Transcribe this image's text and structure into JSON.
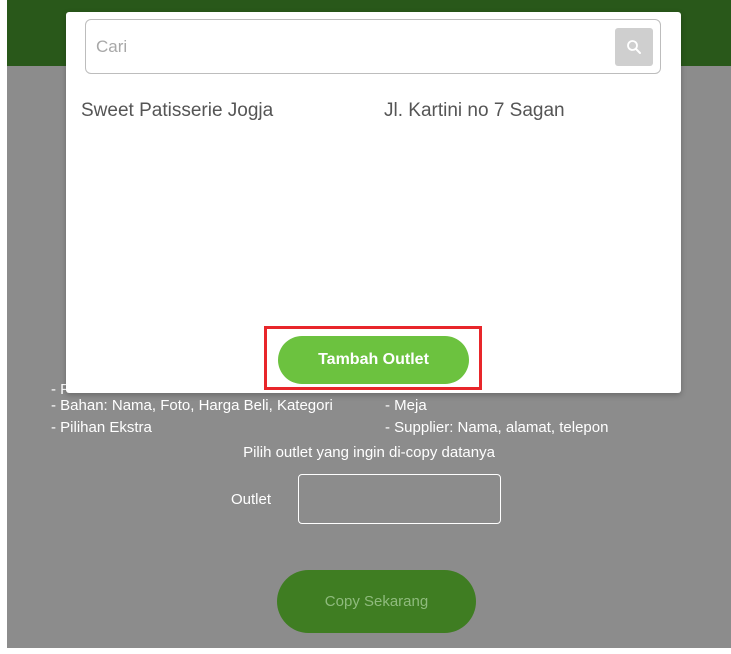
{
  "search": {
    "placeholder": "Cari"
  },
  "outlets": [
    {
      "name": "Sweet Patisserie Jogja",
      "address": "Jl. Kartini no 7 Sagan"
    }
  ],
  "modal": {
    "add_button_label": "Tambah Outlet"
  },
  "background": {
    "partial_item": "- F",
    "left_items": [
      "- Bahan: Nama, Foto, Harga Beli, Kategori",
      "- Pilihan Ekstra"
    ],
    "right_items": [
      "- Meja",
      "- Supplier: Nama, alamat, telepon"
    ],
    "prompt": "Pilih outlet yang ingin di-copy datanya",
    "outlet_label": "Outlet",
    "outlet_value": "",
    "copy_button_label": "Copy Sekarang"
  },
  "colors": {
    "header_green": "#29581a",
    "overlay_grey": "#8c8c8c",
    "button_green": "#6cc23f",
    "highlight_red": "#e8262a"
  },
  "icons": {
    "search": "search-icon"
  }
}
